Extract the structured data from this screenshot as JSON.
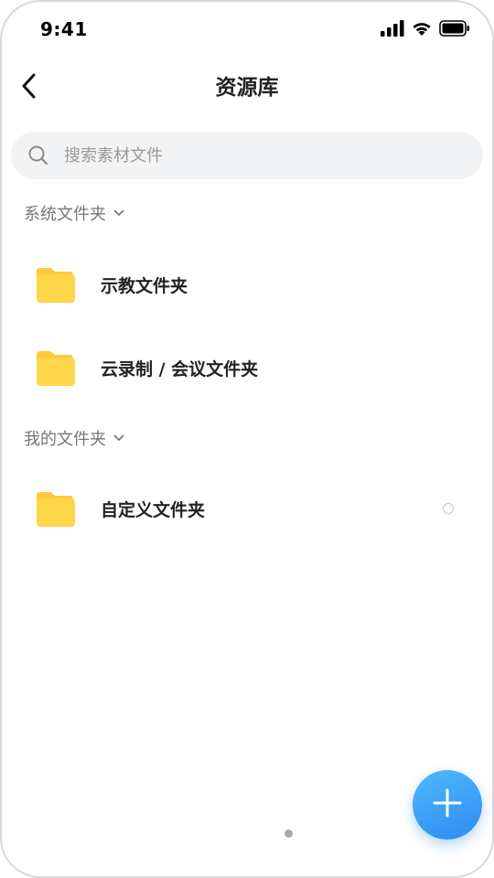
{
  "status_bar": {
    "time": "9:41",
    "icons": [
      "signal-icon",
      "wifi-icon",
      "battery-icon"
    ]
  },
  "nav": {
    "title": "资源库",
    "back_icon": "chevron-left-icon"
  },
  "search": {
    "placeholder": "搜索素材文件",
    "value": ""
  },
  "sections": [
    {
      "title": "系统文件夹",
      "expanded": true,
      "folders": [
        {
          "label": "示教文件夹"
        },
        {
          "label": "云录制 / 会议文件夹"
        }
      ]
    },
    {
      "title": "我的文件夹",
      "expanded": true,
      "folders": [
        {
          "label": "自定义文件夹",
          "has_radio": true
        }
      ]
    }
  ],
  "fab": {
    "icon": "plus-icon"
  },
  "colors": {
    "folder": "#ffd54a",
    "folder_tab": "#ffc83d",
    "accent": "#2d8cf0",
    "search_bg": "#f2f3f5"
  }
}
